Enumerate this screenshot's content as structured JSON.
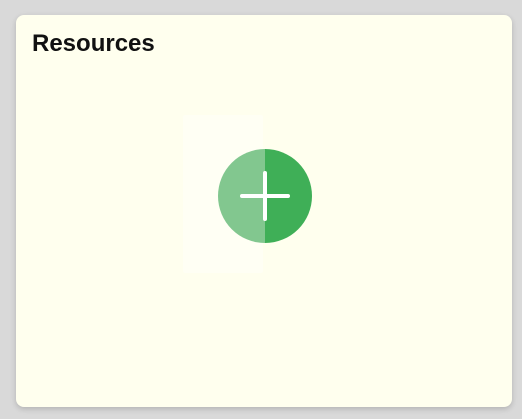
{
  "card": {
    "title": "Resources"
  },
  "add_button": {
    "icon": "plus-icon",
    "colors": {
      "left": "#82c78f",
      "right": "#3faf57",
      "glyph": "#ffffff"
    }
  },
  "colors": {
    "background": "#d9d9d9",
    "card": "#ffffee",
    "title": "#111111"
  }
}
